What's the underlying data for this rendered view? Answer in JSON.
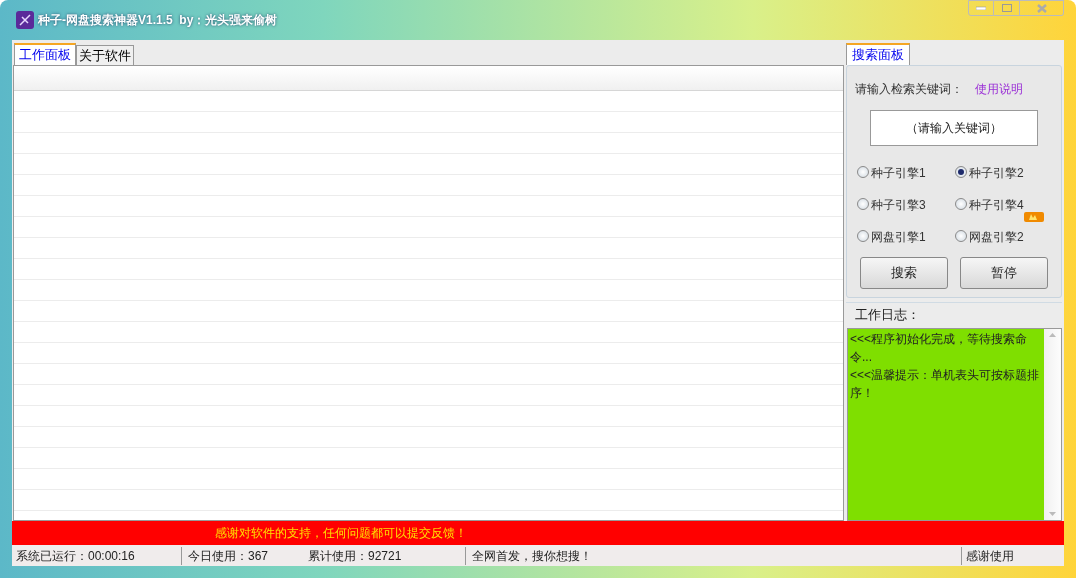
{
  "window": {
    "title": "种子-网盘搜索神器V1.1.5  by：光头强来偷树"
  },
  "tabs": [
    {
      "label": "工作面板",
      "selected": true
    },
    {
      "label": "关于软件",
      "selected": false
    }
  ],
  "search_panel": {
    "tab": {
      "label": "搜索面板",
      "selected": true
    },
    "prompt": "请输入检索关键词：",
    "help_link": "使用说明",
    "keyword_field": {
      "placeholder": "（请输入关键词）"
    },
    "engines": [
      {
        "label": "种子引擎1",
        "selected": false,
        "hot": false
      },
      {
        "label": "种子引擎2",
        "selected": true,
        "hot": false
      },
      {
        "label": "种子引擎3",
        "selected": false,
        "hot": false
      },
      {
        "label": "种子引擎4",
        "selected": false,
        "hot": false
      },
      {
        "label": "网盘引擎1",
        "selected": false,
        "hot": false
      },
      {
        "label": "网盘引擎2",
        "selected": false,
        "hot": true
      }
    ],
    "buttons": [
      "搜索",
      "暂停"
    ]
  },
  "log": {
    "title": "工作日志：",
    "lines": [
      "<<<程序初始化完成，等待搜索命令...",
      "<<<温馨提示：单机表头可按标题排序！"
    ]
  },
  "banner": "感谢对软件的支持，任何问题都可以提交反馈！",
  "status_bar": [
    "系统已运行：00:00:16",
    "今日使用：367",
    "累计使用：92721",
    "全网首发，搜你想搜！",
    "感谢使用"
  ]
}
